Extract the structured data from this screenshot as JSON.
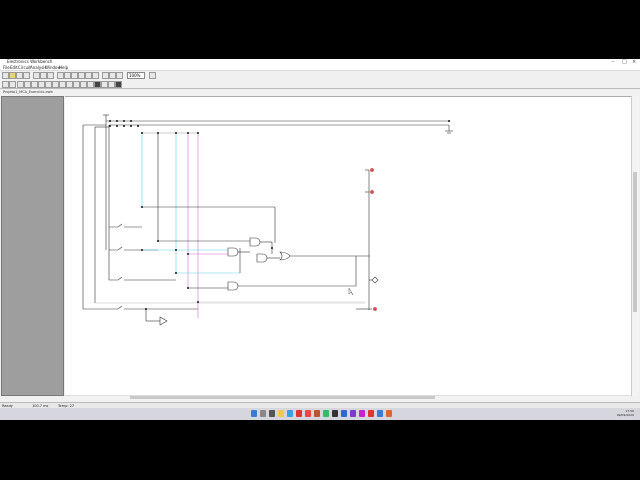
{
  "window": {
    "title": "Electronics Workbench",
    "controls": [
      "–",
      "□",
      "×"
    ]
  },
  "menu": [
    "File",
    "Edit",
    "Circuit",
    "Analysis",
    "Window",
    "Help"
  ],
  "toolbar": {
    "zoom_value": "100%"
  },
  "document": {
    "tab_label": "Projeto1_MCA_Exercício.ewb"
  },
  "status": {
    "ready": "Ready",
    "time": "100.7 ms",
    "temp": "Temp: 27"
  },
  "tray": {
    "time": "17:56",
    "date": "09/09/2020"
  },
  "colors": {
    "cyan_wire": "#5fd3e6",
    "magenta_wire": "#d070d0",
    "led": "#d05050"
  }
}
